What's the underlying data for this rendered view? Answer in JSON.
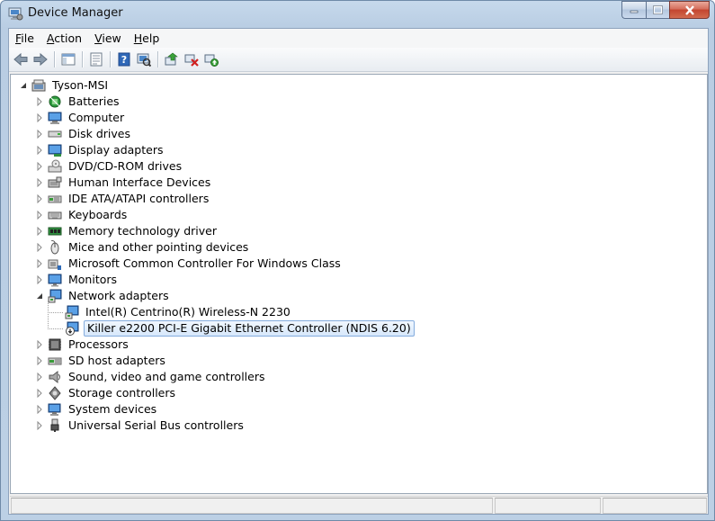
{
  "window": {
    "title": "Device Manager",
    "icon": "device-manager-icon"
  },
  "menu": [
    {
      "key": "F",
      "rest": "ile"
    },
    {
      "key": "A",
      "rest": "ction"
    },
    {
      "key": "V",
      "rest": "iew"
    },
    {
      "key": "H",
      "rest": "elp"
    }
  ],
  "toolbar": {
    "buttons": [
      "back-arrow-icon",
      "forward-arrow-icon",
      "show-hide-console-tree-icon",
      "properties-icon",
      "help-icon",
      "scan-hardware-changes-icon",
      "update-driver-icon",
      "uninstall-device-icon",
      "enable-device-icon"
    ]
  },
  "tree": {
    "root": "Tyson-MSI",
    "categories": [
      {
        "label": "Batteries",
        "icon": "battery-icon"
      },
      {
        "label": "Computer",
        "icon": "computer-icon"
      },
      {
        "label": "Disk drives",
        "icon": "disk-drive-icon"
      },
      {
        "label": "Display adapters",
        "icon": "display-adapter-icon"
      },
      {
        "label": "DVD/CD-ROM drives",
        "icon": "dvd-drive-icon"
      },
      {
        "label": "Human Interface Devices",
        "icon": "hid-icon"
      },
      {
        "label": "IDE ATA/ATAPI controllers",
        "icon": "ide-controller-icon"
      },
      {
        "label": "Keyboards",
        "icon": "keyboard-icon"
      },
      {
        "label": "Memory technology driver",
        "icon": "memory-icon"
      },
      {
        "label": "Mice and other pointing devices",
        "icon": "mouse-icon"
      },
      {
        "label": "Microsoft Common Controller For Windows Class",
        "icon": "controller-icon"
      },
      {
        "label": "Monitors",
        "icon": "monitor-icon"
      },
      {
        "label": "Network adapters",
        "icon": "network-adapter-icon",
        "expanded": true,
        "children": [
          {
            "label": "Intel(R) Centrino(R) Wireless-N 2230",
            "icon": "network-adapter-icon"
          },
          {
            "label": "Killer e2200 PCI-E Gigabit Ethernet Controller (NDIS 6.20)",
            "icon": "network-adapter-disabled-icon",
            "selected": true
          }
        ]
      },
      {
        "label": "Processors",
        "icon": "processor-icon"
      },
      {
        "label": "SD host adapters",
        "icon": "sd-host-icon"
      },
      {
        "label": "Sound, video and game controllers",
        "icon": "speaker-icon"
      },
      {
        "label": "Storage controllers",
        "icon": "storage-controller-icon"
      },
      {
        "label": "System devices",
        "icon": "system-devices-icon"
      },
      {
        "label": "Universal Serial Bus controllers",
        "icon": "usb-icon"
      }
    ]
  }
}
